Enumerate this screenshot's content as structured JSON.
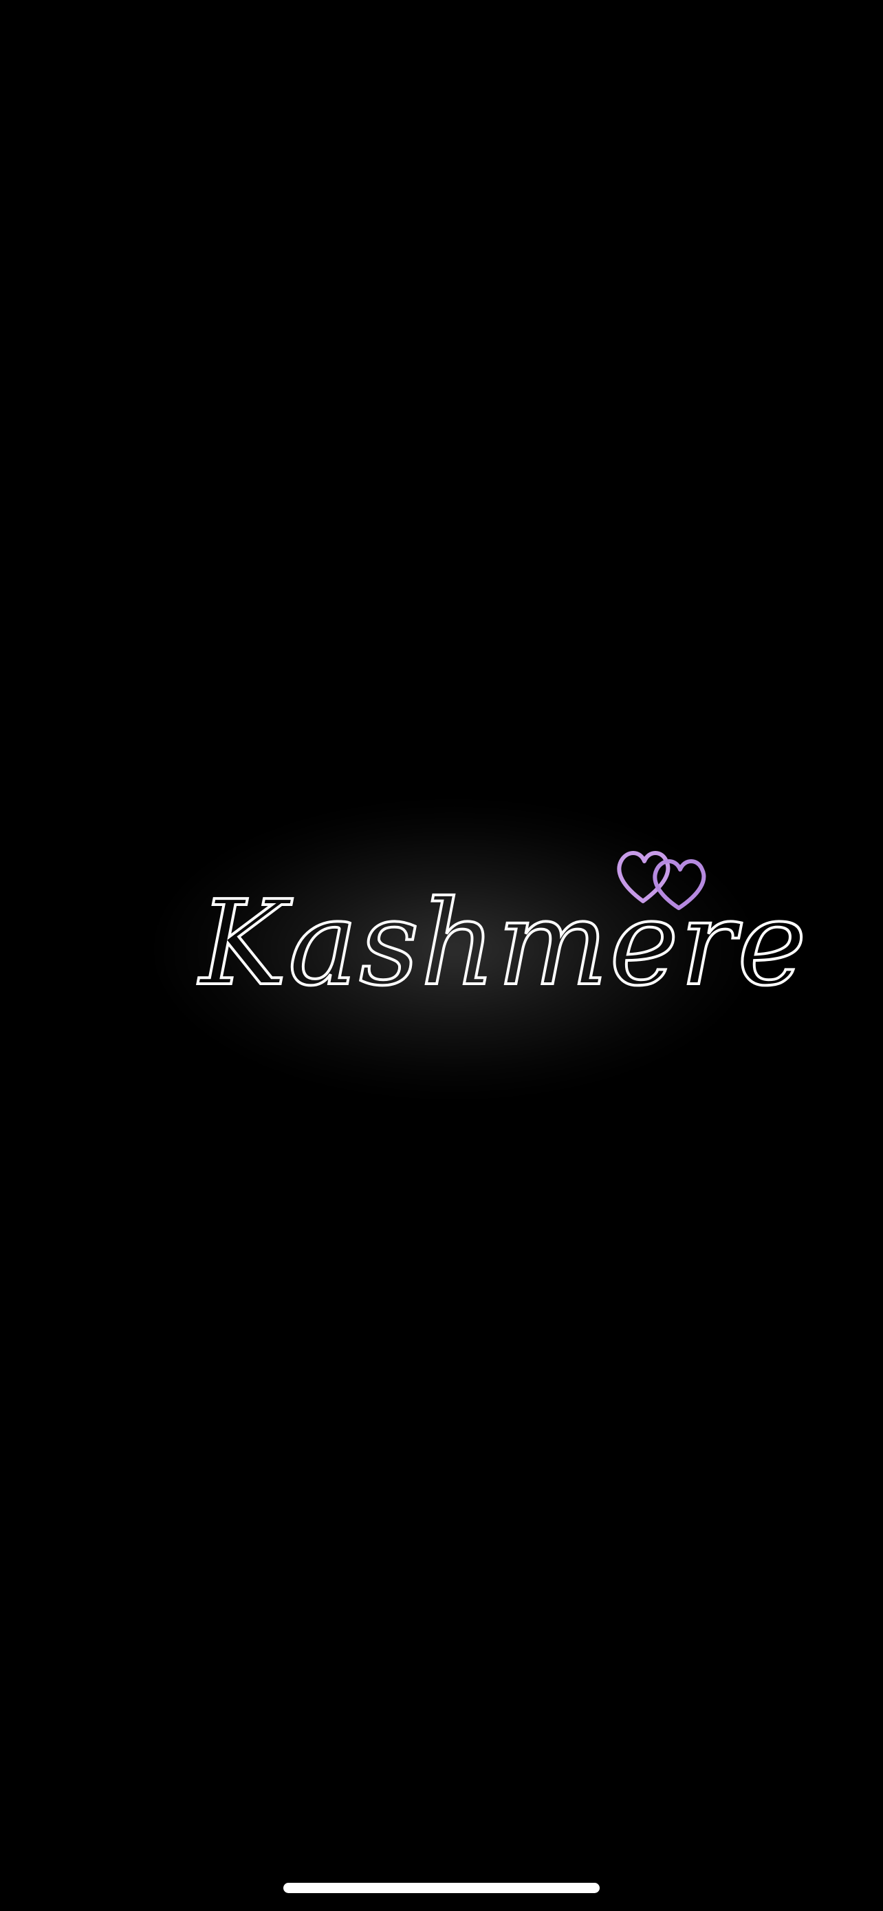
{
  "splash": {
    "brand_name": "Kashmere",
    "icon": "double-heart-icon"
  },
  "colors": {
    "background": "#000000",
    "wordmark": "#ffffff",
    "heart_primary": "#c79be8",
    "heart_secondary": "#b68ae0",
    "home_indicator": "#ffffff"
  }
}
